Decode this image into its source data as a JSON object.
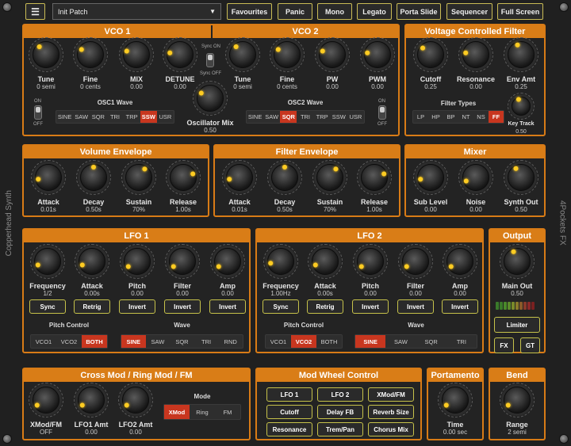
{
  "topbar": {
    "menu_icon": "hamburger-icon",
    "patch_name": "Init Patch",
    "favourites": "Favourites",
    "panic": "Panic",
    "mono": "Mono",
    "legato": "Legato",
    "porta_slide": "Porta Slide",
    "sequencer": "Sequencer",
    "full_screen": "Full Screen"
  },
  "side": {
    "left": "Copperhead Synth",
    "right": "4Pockets FX"
  },
  "vco1": {
    "title": "VCO 1",
    "knobs": [
      {
        "label": "Tune",
        "value": "0 semi"
      },
      {
        "label": "Fine",
        "value": "0 cents"
      },
      {
        "label": "MIX",
        "value": "0.00"
      },
      {
        "label": "DETUNE",
        "value": "0.00"
      }
    ],
    "on": "ON",
    "off": "OFF",
    "wave_title": "OSC1 Wave",
    "waves": [
      "SINE",
      "SAW",
      "SQR",
      "TRI",
      "TRP",
      "SSW",
      "USR"
    ],
    "wave_selected": "SSW"
  },
  "sync": {
    "on": "Sync ON",
    "off": "Sync OFF"
  },
  "osc_mix": {
    "label": "Oscillator Mix",
    "value": "0.50"
  },
  "vco2": {
    "title": "VCO 2",
    "knobs": [
      {
        "label": "Tune",
        "value": "0 semi"
      },
      {
        "label": "Fine",
        "value": "0 cents"
      },
      {
        "label": "PW",
        "value": "0.00"
      },
      {
        "label": "PWM",
        "value": "0.00"
      }
    ],
    "on": "ON",
    "off": "OFF",
    "wave_title": "OSC2 Wave",
    "waves": [
      "SINE",
      "SAW",
      "SQR",
      "TRI",
      "TRP",
      "SSW",
      "USR"
    ],
    "wave_selected": "SQR"
  },
  "vcf": {
    "title": "Voltage Controlled Filter",
    "knobs": [
      {
        "label": "Cutoff",
        "value": "0.25"
      },
      {
        "label": "Resonance",
        "value": "0.00"
      },
      {
        "label": "Env Amt",
        "value": "0.25"
      }
    ],
    "types_title": "Filter Types",
    "types": [
      "LP",
      "HP",
      "BP",
      "NT",
      "NS",
      "FF"
    ],
    "type_selected": "FF",
    "keytrack": {
      "label": "Key Track",
      "value": "0.50"
    }
  },
  "venv": {
    "title": "Volume Envelope",
    "knobs": [
      {
        "label": "Attack",
        "value": "0.01s"
      },
      {
        "label": "Decay",
        "value": "0.50s"
      },
      {
        "label": "Sustain",
        "value": "70%"
      },
      {
        "label": "Release",
        "value": "1.00s"
      }
    ]
  },
  "fenv": {
    "title": "Filter Envelope",
    "knobs": [
      {
        "label": "Attack",
        "value": "0.01s"
      },
      {
        "label": "Decay",
        "value": "0.50s"
      },
      {
        "label": "Sustain",
        "value": "70%"
      },
      {
        "label": "Release",
        "value": "1.00s"
      }
    ]
  },
  "mixer": {
    "title": "Mixer",
    "knobs": [
      {
        "label": "Sub Level",
        "value": "0.00"
      },
      {
        "label": "Noise",
        "value": "0.00"
      },
      {
        "label": "Synth Out",
        "value": "0.50"
      }
    ]
  },
  "lfo1": {
    "title": "LFO 1",
    "knobs": [
      {
        "label": "Frequency",
        "value": "1/2"
      },
      {
        "label": "Attack",
        "value": "0.00s"
      },
      {
        "label": "Pitch",
        "value": "0.00"
      },
      {
        "label": "Filter",
        "value": "0.00"
      },
      {
        "label": "Amp",
        "value": "0.00"
      }
    ],
    "buttons": [
      "Sync",
      "Retrig",
      "Invert",
      "Invert",
      "Invert"
    ],
    "pitch_title": "Pitch Control",
    "pitch": [
      "VCO1",
      "VCO2",
      "BOTH"
    ],
    "pitch_selected": "BOTH",
    "wave_title": "Wave",
    "waves": [
      "SINE",
      "SAW",
      "SQR",
      "TRI",
      "RND"
    ],
    "wave_selected": "SINE"
  },
  "lfo2": {
    "title": "LFO 2",
    "knobs": [
      {
        "label": "Frequency",
        "value": "1.00Hz"
      },
      {
        "label": "Attack",
        "value": "0.00s"
      },
      {
        "label": "Pitch",
        "value": "0.00"
      },
      {
        "label": "Filter",
        "value": "0.00"
      },
      {
        "label": "Amp",
        "value": "0.00"
      }
    ],
    "buttons": [
      "Sync",
      "Retrig",
      "Invert",
      "Invert",
      "Invert"
    ],
    "pitch_title": "Pitch Control",
    "pitch": [
      "VCO1",
      "VCO2",
      "BOTH"
    ],
    "pitch_selected": "VCO2",
    "wave_title": "Wave",
    "waves": [
      "SINE",
      "SAW",
      "SQR",
      "TRI"
    ],
    "wave_selected": "SINE"
  },
  "output": {
    "title": "Output",
    "label": "Main Out",
    "value": "0.50",
    "limiter": "Limiter",
    "fx": "FX",
    "gt": "GT"
  },
  "cross": {
    "title": "Cross Mod / Ring Mod / FM",
    "knobs": [
      {
        "label": "XMod/FM",
        "value": "OFF"
      },
      {
        "label": "LFO1 Amt",
        "value": "0.00"
      },
      {
        "label": "LFO2 Amt",
        "value": "0.00"
      }
    ],
    "mode_title": "Mode",
    "modes": [
      "XMod",
      "Ring",
      "FM"
    ],
    "mode_selected": "XMod"
  },
  "modwheel": {
    "title": "Mod Wheel Control",
    "buttons": [
      "LFO 1",
      "LFO 2",
      "XMod/FM",
      "Cutoff",
      "Delay FB",
      "Reverb Size",
      "Resonance",
      "Trem/Pan",
      "Chorus Mix"
    ]
  },
  "porta": {
    "title": "Portamento",
    "label": "Time",
    "value": "0.00 sec"
  },
  "bend": {
    "title": "Bend",
    "label": "Range",
    "value": "2 semi"
  },
  "colors": {
    "accent": "#d97d17",
    "selected": "#c8361f",
    "button_border": "#c6c24a",
    "knob_dot": "#ffcc22"
  }
}
